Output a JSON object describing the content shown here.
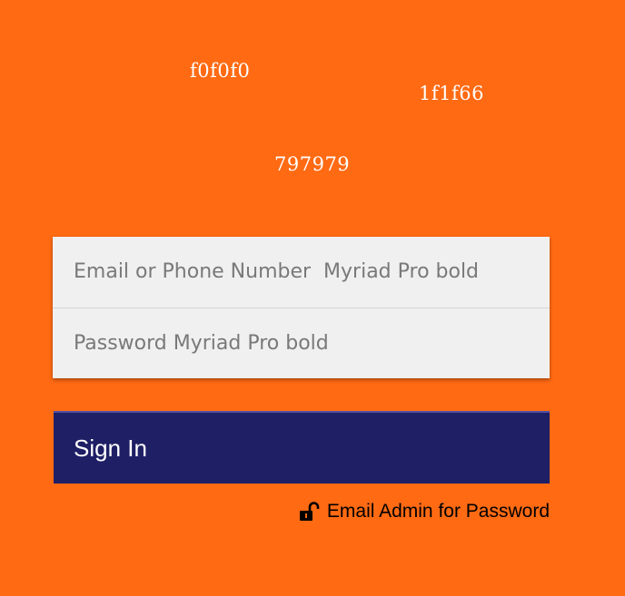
{
  "notes": {
    "color_input_bg": "f0f0f0",
    "color_button_bg": "1f1f66",
    "color_placeholder": "797979"
  },
  "login": {
    "email_placeholder": "Email or Phone Number  Myriad Pro bold",
    "email_value": "",
    "password_placeholder": "Password Myriad Pro bold",
    "password_value": "",
    "sign_in_label": "Sign In",
    "admin_link_label": "Email Admin for Password",
    "admin_link_icon": "unlock-icon"
  },
  "colors": {
    "background": "#ff6a13",
    "input_bg": "#f0f0f0",
    "button_bg": "#1f1f66",
    "placeholder": "#797979",
    "note_text": "#ffffff"
  }
}
